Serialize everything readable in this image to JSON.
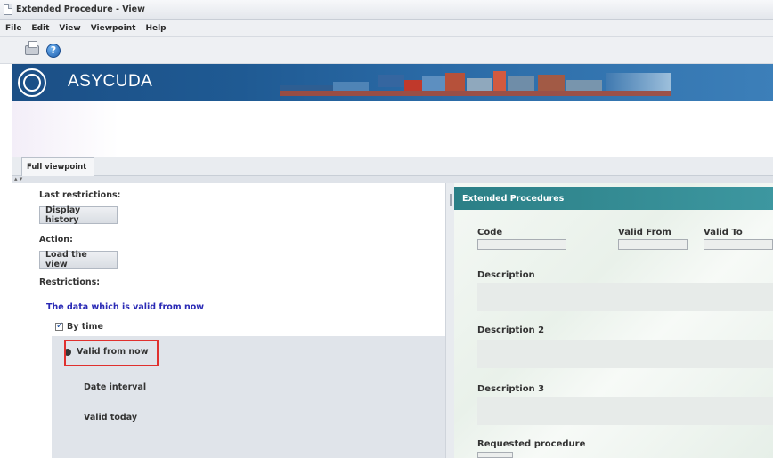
{
  "window": {
    "title": "Extended Procedure - View"
  },
  "menu": [
    "File",
    "Edit",
    "View",
    "Viewpoint",
    "Help"
  ],
  "toolbar": {
    "print_icon": "printer-icon",
    "help_icon": "help-icon",
    "help_glyph": "?"
  },
  "banner": {
    "brand": "ASYCUDA",
    "logo": "un-logo"
  },
  "viewpoint_tab": "Full viewpoint",
  "collapse_glyph": "▴ ▾",
  "left": {
    "last_restrictions_label": "Last restrictions:",
    "display_history_button": "Display history",
    "action_label": "Action:",
    "load_view_button": "Load the view",
    "restrictions_label": "Restrictions:",
    "restriction_summary": "The data which is valid from now",
    "by_time_label": "By time",
    "by_time_checked": true,
    "radio_options": [
      {
        "label": "Valid from now",
        "selected": true
      },
      {
        "label": "Date interval",
        "selected": false
      },
      {
        "label": "Valid today",
        "selected": false
      }
    ]
  },
  "right": {
    "header": "Extended Procedures",
    "code_label": "Code",
    "valid_from_label": "Valid From",
    "valid_to_label": "Valid To",
    "description_label": "Description",
    "description2_label": "Description 2",
    "description3_label": "Description 3",
    "requested_procedure_label": "Requested procedure"
  },
  "colors": {
    "banner_blue": "#1f5a93",
    "panel_header_teal": "#2b7f86",
    "highlight_red": "#e0302e",
    "link_blue": "#2a2ab5"
  }
}
